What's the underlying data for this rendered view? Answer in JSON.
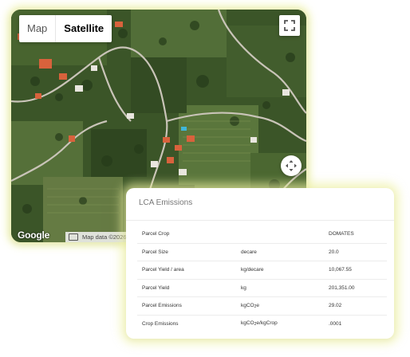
{
  "map": {
    "toggle": {
      "map_label": "Map",
      "satellite_label": "Satellite",
      "active": "Satellite"
    },
    "google_logo": "Google",
    "footer_text": "Map data ©2026 Im",
    "colors": {
      "terrain_dark": "#2f4a22",
      "terrain_mid": "#4f6b35",
      "road": "#c9c4b8",
      "roof": "#d8623c"
    }
  },
  "lca": {
    "title": "LCA Emissions",
    "rows": [
      {
        "label": "Parcel Crop",
        "unit": "",
        "value": "DOMATES"
      },
      {
        "label": "Parcel Size",
        "unit": "decare",
        "value": "20.0"
      },
      {
        "label": "Parcel Yield / area",
        "unit": "kg/decare",
        "value": "10,067.55"
      },
      {
        "label": "Parcel Yield",
        "unit": "kg",
        "value": "201,351.00"
      },
      {
        "label": "Parcel Emissions",
        "unit_prefix": "kgCO",
        "unit_sub": "2",
        "unit_suffix": "e",
        "value": "29.02"
      },
      {
        "label": "Crop Emissions",
        "unit_prefix": "kgCO",
        "unit_sub": "2",
        "unit_suffix": "e/kgCrop",
        "value": ".0001"
      }
    ]
  }
}
